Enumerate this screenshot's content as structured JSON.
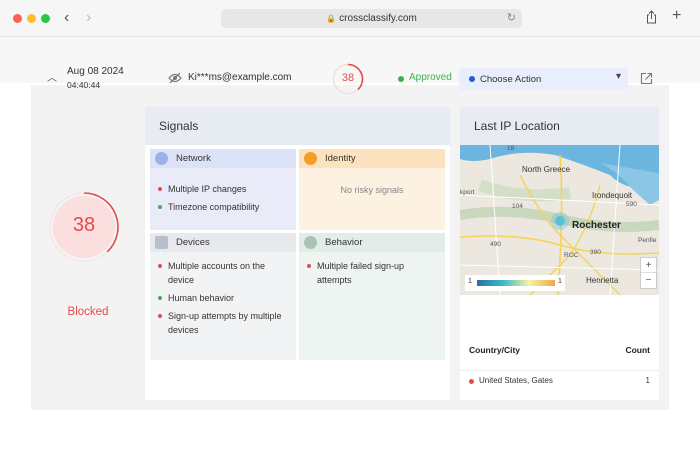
{
  "browser": {
    "url": "crossclassify.com"
  },
  "record": {
    "date": "Aug 08 2024",
    "time": "04:40:44",
    "email": "Ki***ms@example.com",
    "score": "38",
    "score_fraction": 0.38,
    "status": "Approved",
    "action_placeholder": "Choose Action",
    "decision": "Blocked"
  },
  "signals": {
    "title": "Signals",
    "network": {
      "label": "Network",
      "items": [
        {
          "text": "Multiple IP changes",
          "level": "red"
        },
        {
          "text": "Timezone compatibility",
          "level": "green"
        }
      ]
    },
    "identity": {
      "label": "Identity",
      "empty": "No risky signals"
    },
    "devices": {
      "label": "Devices",
      "items": [
        {
          "text": "Multiple accounts on the device",
          "level": "red"
        },
        {
          "text": "Human behavior",
          "level": "green"
        },
        {
          "text": "Sign-up attempts by multiple devices",
          "level": "red"
        }
      ]
    },
    "behavior": {
      "label": "Behavior",
      "items": [
        {
          "text": "Multiple failed sign-up attempts",
          "level": "red"
        }
      ]
    }
  },
  "last_ip": {
    "title": "Last IP Location",
    "map": {
      "labels": {
        "north_greece": "North Greece",
        "irondequoit": "Irondequoit",
        "rochester": "Rochester",
        "penfield": "Penfie",
        "henrietta": "Henrietta",
        "kport": "kport",
        "roc": "ROC",
        "r18": "18",
        "r590": "590",
        "r104": "104",
        "r490": "490",
        "r390": "390"
      },
      "legend_min": "1",
      "legend_max": "1",
      "zoom_in": "+",
      "zoom_out": "−"
    },
    "table": {
      "col_city": "Country/City",
      "col_count": "Count",
      "rows": [
        {
          "city": "United States, Gates",
          "count": "1"
        }
      ]
    }
  },
  "colors": {
    "danger": "#e24c4c",
    "success": "#3cb34a",
    "accent": "#1f5fd6"
  }
}
